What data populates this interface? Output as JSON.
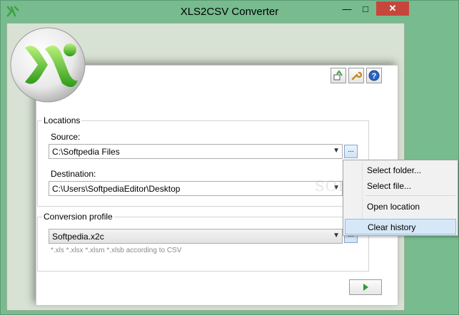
{
  "window": {
    "title": "XLS2CSV Converter",
    "accent": "#77bb8e",
    "close_color": "#c7463c"
  },
  "toolbar": {
    "icons": [
      "export-icon",
      "wrench-icon",
      "help-icon"
    ]
  },
  "locations": {
    "legend": "Locations",
    "source_label": "Source:",
    "source_value": "C:\\Softpedia Files",
    "destination_label": "Destination:",
    "destination_value": "C:\\Users\\SoftpediaEditor\\Desktop",
    "browse_label": "..."
  },
  "profile": {
    "legend": "Conversion profile",
    "value": "Softpedia.x2c",
    "hint": "*.xls *.xlsx *.xlsm *.xlsb according to CSV",
    "browse_label": "..."
  },
  "context_menu": {
    "items": [
      "Select folder...",
      "Select file...",
      "Open location",
      "Clear history"
    ],
    "selected": "Clear history"
  },
  "watermark": "SOFTPEDIA"
}
